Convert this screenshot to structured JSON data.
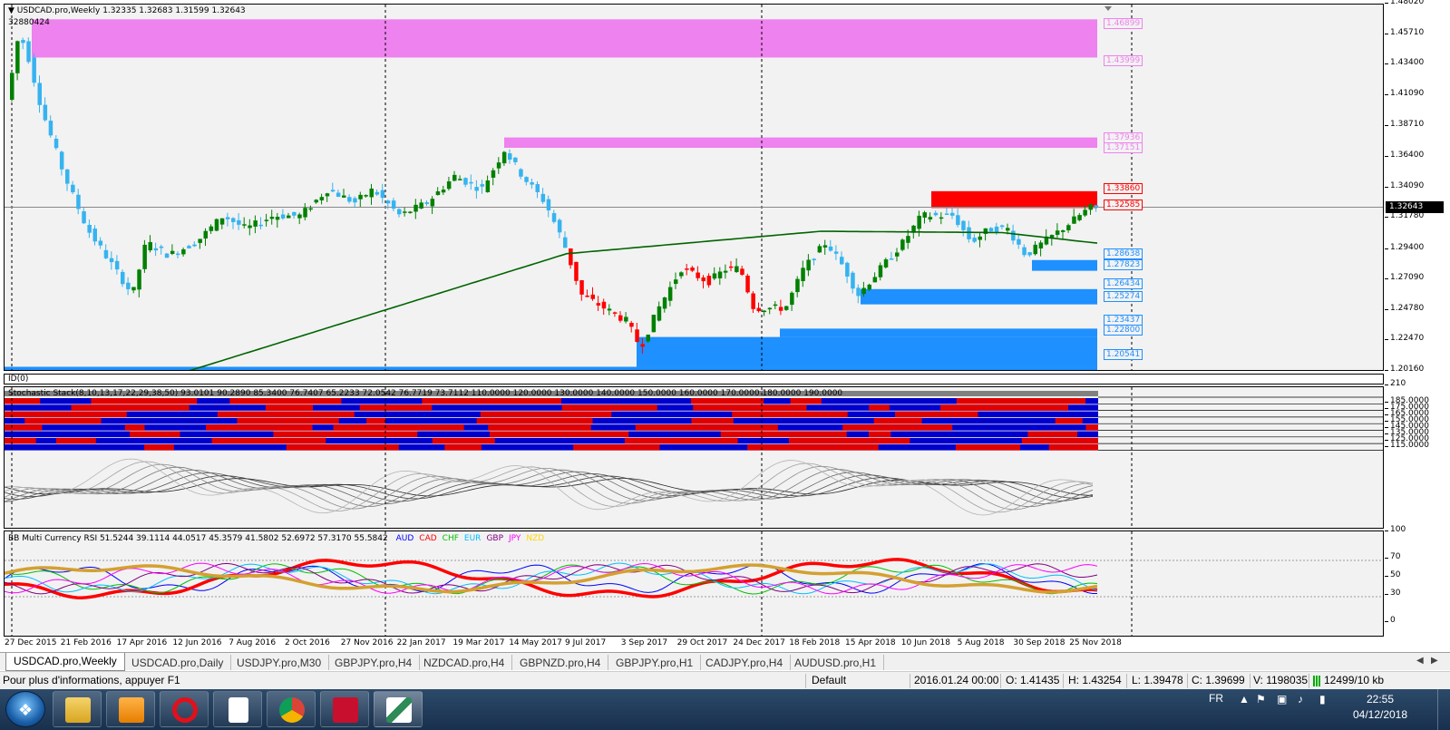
{
  "chart": {
    "title": "USDCAD.pro,Weekly",
    "ohlc": "1.32335 1.32683 1.31599 1.32643",
    "volume_label": "32880424",
    "price_ticks": [
      "1.48020",
      "1.45710",
      "1.43400",
      "1.41090",
      "1.38710",
      "1.36400",
      "1.34090",
      "1.31780",
      "1.29400",
      "1.27090",
      "1.24780",
      "1.22470",
      "1.20160"
    ],
    "price_range": [
      1.2016,
      1.4802
    ],
    "current_price": "1.32643",
    "levels": {
      "supply_top_high": "1.46899",
      "supply_top_low": "1.43999",
      "supply_mid_high": "1.37936",
      "supply_mid_low": "1.37151",
      "red_high": "1.33860",
      "red_low": "1.32585",
      "demand1_high": "1.28638",
      "demand1_low": "1.27823",
      "demand2_high": "1.26434",
      "demand2_low": "1.25274",
      "demand3_high": "1.23437",
      "demand3_a": "1.22800",
      "demand3_b": "1.22800",
      "demand4_a": "1.20541",
      "demand4_b": "1.20541"
    },
    "colors": {
      "supply": "#ee82ee",
      "red_zone": "#ff0000",
      "demand": "#1e90ff",
      "bull": "#008000",
      "bear": "#36b3f0",
      "bear_red": "#ff0000",
      "ma": "#006400"
    }
  },
  "id_pane": {
    "label": "ID(0)"
  },
  "stoch": {
    "label": "Stochastic Stack(8,10,13,17,22,29,38,50) 93.0101 90.2890 85.3400 76.7407 65.2233 72.0542 76.7719 73.7112 110.0000 120.0000 130.0000 140.0000 150.0000 160.0000 170.0000 180.0000 190.0000",
    "scale_ticks": [
      "210",
      "185.0000",
      "175.0000",
      "165.0000",
      "155.0000",
      "145.0000",
      "135.0000",
      "125.0000",
      "115.0000"
    ]
  },
  "rsi": {
    "label": "BB Multi Currency RSI 51.5244 39.1114 44.0517 45.3579 41.5802 52.6972 57.3170 55.5842",
    "currencies": [
      {
        "name": "AUD",
        "color": "#0000ff"
      },
      {
        "name": "CAD",
        "color": "#ff0000"
      },
      {
        "name": "CHF",
        "color": "#00c000"
      },
      {
        "name": "EUR",
        "color": "#00bfff"
      },
      {
        "name": "GBP",
        "color": "#800080"
      },
      {
        "name": "JPY",
        "color": "#ff00ff"
      },
      {
        "name": "NZD",
        "color": "#ffd700"
      }
    ],
    "scale_ticks": [
      "100",
      "70",
      "50",
      "30",
      "0"
    ]
  },
  "time_axis": [
    "27 Dec 2015",
    "21 Feb 2016",
    "17 Apr 2016",
    "12 Jun 2016",
    "7 Aug 2016",
    "2 Oct 2016",
    "27 Nov 2016",
    "22 Jan 2017",
    "19 Mar 2017",
    "14 May 2017",
    "9 Jul 2017",
    "3 Sep 2017",
    "29 Oct 2017",
    "24 Dec 2017",
    "18 Feb 2018",
    "15 Apr 2018",
    "10 Jun 2018",
    "5 Aug 2018",
    "30 Sep 2018",
    "25 Nov 2018"
  ],
  "tabs": [
    "USDCAD.pro,Weekly",
    "USDCAD.pro,Daily",
    "USDJPY.pro,M30",
    "GBPJPY.pro,H4",
    "NZDCAD.pro,H4",
    "GBPNZD.pro,H4",
    "GBPJPY.pro,H1",
    "CADJPY.pro,H4",
    "AUDUSD.pro,H1"
  ],
  "status": {
    "help": "Pour plus d'informations, appuyer F1",
    "profile": "Default",
    "datetime": "2016.01.24 00:00",
    "open": "O: 1.41435",
    "high": "H: 1.43254",
    "low": "L: 1.39478",
    "close": "C: 1.39699",
    "volume": "V: 1198035",
    "traffic": "12499/10 kb"
  },
  "taskbar": {
    "lang": "FR",
    "time": "22:55",
    "date": "04/12/2018"
  }
}
